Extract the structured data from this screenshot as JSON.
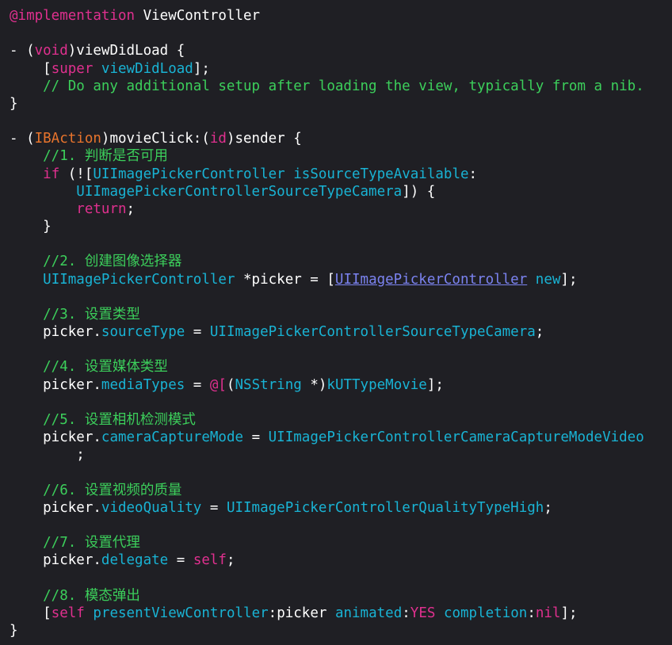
{
  "editor": {
    "colors": {
      "background": "#1f1f24",
      "plain": "#ffffff",
      "keyword": "#e0308f",
      "comment": "#3ccf5b",
      "sysclass": "#19b3d4",
      "method": "#19b3d4",
      "link": "#7b83f0",
      "macro": "#e8742c"
    },
    "lines": [
      [
        {
          "t": "@implementation",
          "k": "keyword"
        },
        {
          "t": " ViewController",
          "k": "plain"
        }
      ],
      [],
      [
        {
          "t": "- (",
          "k": "plain"
        },
        {
          "t": "void",
          "k": "keyword"
        },
        {
          "t": ")viewDidLoad {",
          "k": "plain"
        }
      ],
      [
        {
          "t": "    [",
          "k": "plain"
        },
        {
          "t": "super",
          "k": "keyword"
        },
        {
          "t": " ",
          "k": "plain"
        },
        {
          "t": "viewDidLoad",
          "k": "method"
        },
        {
          "t": "];",
          "k": "plain"
        }
      ],
      [
        {
          "t": "    // Do any additional setup after loading the view, typically from a nib.",
          "k": "comment"
        }
      ],
      [
        {
          "t": "}",
          "k": "plain"
        }
      ],
      [],
      [
        {
          "t": "- (",
          "k": "plain"
        },
        {
          "t": "IBAction",
          "k": "macro"
        },
        {
          "t": ")movieClick:(",
          "k": "plain"
        },
        {
          "t": "id",
          "k": "keyword"
        },
        {
          "t": ")sender {",
          "k": "plain"
        }
      ],
      [
        {
          "t": "    //1. 判断是否可用",
          "k": "comment"
        }
      ],
      [
        {
          "t": "    ",
          "k": "plain"
        },
        {
          "t": "if",
          "k": "keyword"
        },
        {
          "t": " (![",
          "k": "plain"
        },
        {
          "t": "UIImagePickerController",
          "k": "sysclass"
        },
        {
          "t": " ",
          "k": "plain"
        },
        {
          "t": "isSourceTypeAvailable",
          "k": "method"
        },
        {
          "t": ":",
          "k": "plain"
        }
      ],
      [
        {
          "t": "        ",
          "k": "plain"
        },
        {
          "t": "UIImagePickerControllerSourceTypeCamera",
          "k": "sysclass"
        },
        {
          "t": "]) {",
          "k": "plain"
        }
      ],
      [
        {
          "t": "        ",
          "k": "plain"
        },
        {
          "t": "return",
          "k": "keyword"
        },
        {
          "t": ";",
          "k": "plain"
        }
      ],
      [
        {
          "t": "    }",
          "k": "plain"
        }
      ],
      [],
      [
        {
          "t": "    //2. 创建图像选择器",
          "k": "comment"
        }
      ],
      [
        {
          "t": "    ",
          "k": "plain"
        },
        {
          "t": "UIImagePickerController",
          "k": "sysclass"
        },
        {
          "t": " *picker = [",
          "k": "plain"
        },
        {
          "t": "UIImagePickerController",
          "k": "link"
        },
        {
          "t": " ",
          "k": "plain"
        },
        {
          "t": "new",
          "k": "method"
        },
        {
          "t": "];",
          "k": "plain"
        }
      ],
      [],
      [
        {
          "t": "    //3. 设置类型",
          "k": "comment"
        }
      ],
      [
        {
          "t": "    picker.",
          "k": "plain"
        },
        {
          "t": "sourceType",
          "k": "method"
        },
        {
          "t": " = ",
          "k": "plain"
        },
        {
          "t": "UIImagePickerControllerSourceTypeCamera",
          "k": "sysclass"
        },
        {
          "t": ";",
          "k": "plain"
        }
      ],
      [],
      [
        {
          "t": "    //4. 设置媒体类型",
          "k": "comment"
        }
      ],
      [
        {
          "t": "    picker.",
          "k": "plain"
        },
        {
          "t": "mediaTypes",
          "k": "method"
        },
        {
          "t": " = ",
          "k": "plain"
        },
        {
          "t": "@[",
          "k": "keyword"
        },
        {
          "t": "(",
          "k": "plain"
        },
        {
          "t": "NSString",
          "k": "sysclass"
        },
        {
          "t": " *)",
          "k": "plain"
        },
        {
          "t": "kUTTypeMovie",
          "k": "sysclass"
        },
        {
          "t": "];",
          "k": "plain"
        }
      ],
      [],
      [
        {
          "t": "    //5. 设置相机检测模式",
          "k": "comment"
        }
      ],
      [
        {
          "t": "    picker.",
          "k": "plain"
        },
        {
          "t": "cameraCaptureMode",
          "k": "method"
        },
        {
          "t": " = ",
          "k": "plain"
        },
        {
          "t": "UIImagePickerControllerCameraCaptureModeVideo",
          "k": "sysclass"
        }
      ],
      [
        {
          "t": "        ;",
          "k": "plain"
        }
      ],
      [],
      [
        {
          "t": "    //6. 设置视频的质量",
          "k": "comment"
        }
      ],
      [
        {
          "t": "    picker.",
          "k": "plain"
        },
        {
          "t": "videoQuality",
          "k": "method"
        },
        {
          "t": " = ",
          "k": "plain"
        },
        {
          "t": "UIImagePickerControllerQualityTypeHigh",
          "k": "sysclass"
        },
        {
          "t": ";",
          "k": "plain"
        }
      ],
      [],
      [
        {
          "t": "    //7. 设置代理",
          "k": "comment"
        }
      ],
      [
        {
          "t": "    picker.",
          "k": "plain"
        },
        {
          "t": "delegate",
          "k": "method"
        },
        {
          "t": " = ",
          "k": "plain"
        },
        {
          "t": "self",
          "k": "keyword"
        },
        {
          "t": ";",
          "k": "plain"
        }
      ],
      [],
      [
        {
          "t": "    //8. 模态弹出",
          "k": "comment"
        }
      ],
      [
        {
          "t": "    [",
          "k": "plain"
        },
        {
          "t": "self",
          "k": "keyword"
        },
        {
          "t": " ",
          "k": "plain"
        },
        {
          "t": "presentViewController",
          "k": "method"
        },
        {
          "t": ":picker ",
          "k": "plain"
        },
        {
          "t": "animated",
          "k": "method"
        },
        {
          "t": ":",
          "k": "plain"
        },
        {
          "t": "YES",
          "k": "keyword"
        },
        {
          "t": " ",
          "k": "plain"
        },
        {
          "t": "completion",
          "k": "method"
        },
        {
          "t": ":",
          "k": "plain"
        },
        {
          "t": "nil",
          "k": "keyword"
        },
        {
          "t": "];",
          "k": "plain"
        }
      ],
      [
        {
          "t": "}",
          "k": "plain"
        }
      ]
    ]
  }
}
